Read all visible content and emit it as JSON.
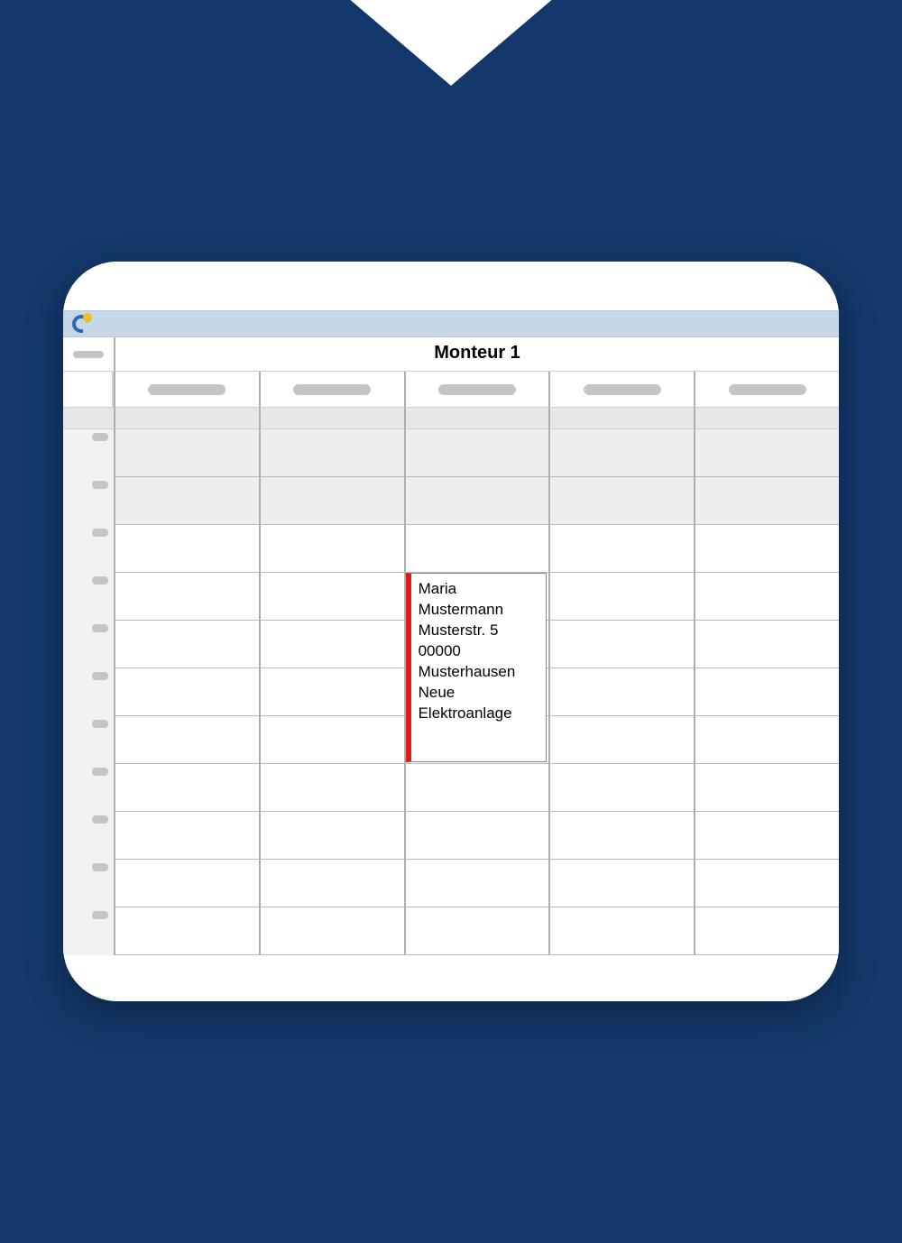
{
  "calendar": {
    "resource_title": "Monteur 1",
    "columns": 5,
    "body_rows": 11,
    "off_rows": 2,
    "event": {
      "lines": [
        "Maria",
        "Mustermann",
        "Musterstr. 5",
        "00000",
        "Musterhausen",
        "Neue",
        "Elektroanlage"
      ],
      "accent_color": "#e21a1a",
      "col_index": 2,
      "row_start": 3,
      "row_span": 4
    }
  }
}
